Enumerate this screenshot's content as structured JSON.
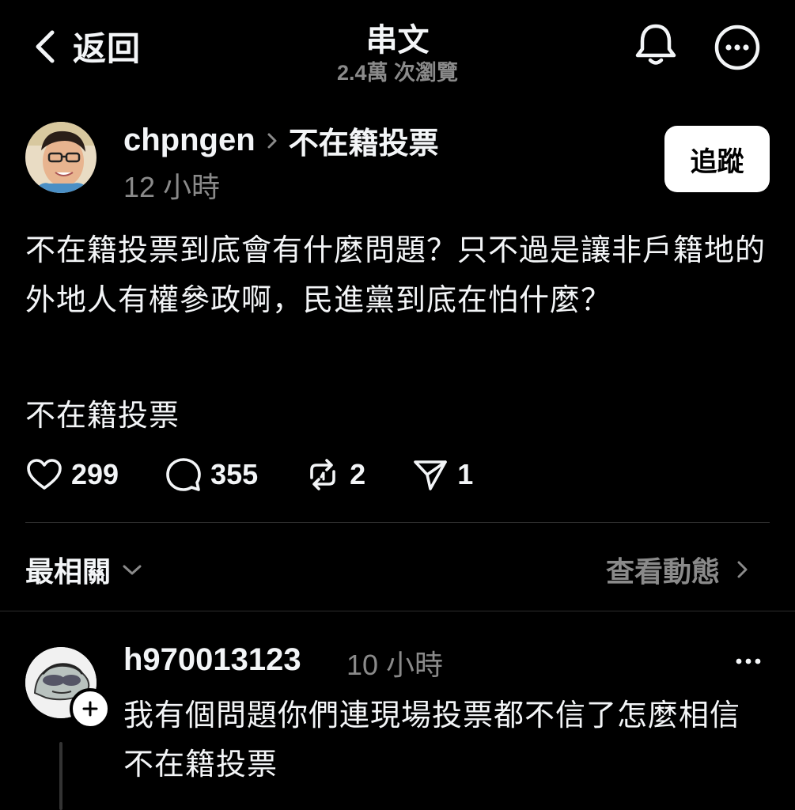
{
  "header": {
    "back_label": "返回",
    "title": "串文",
    "views": "2.4萬 次瀏覽"
  },
  "post": {
    "author": "chpngen",
    "topic": "不在籍投票",
    "time": "12 小時",
    "follow_label": "追蹤",
    "text": "不在籍投票到底會有什麼問題？只不過是讓非戶籍地的外地人有權參政啊，民進黨到底在怕什麼？",
    "tag": "不在籍投票",
    "likes": "299",
    "replies": "355",
    "reposts": "2",
    "shares": "1"
  },
  "sort": {
    "label": "最相關",
    "activity_label": "查看動態"
  },
  "reply": {
    "user": "h970013123",
    "time": "10 小時",
    "text": "我有個問題你們連現場投票都不信了怎麼相信不在籍投票"
  },
  "icons": {
    "back": "chevron-left-icon",
    "bell": "bell-icon",
    "more": "more-circle-icon",
    "like": "heart-icon",
    "reply": "comment-icon",
    "repost": "repost-icon",
    "share": "send-icon"
  },
  "colors": {
    "background": "#000000",
    "text": "#f3f5f7",
    "muted": "#8a8a8a",
    "follow_bg": "#ffffff"
  }
}
